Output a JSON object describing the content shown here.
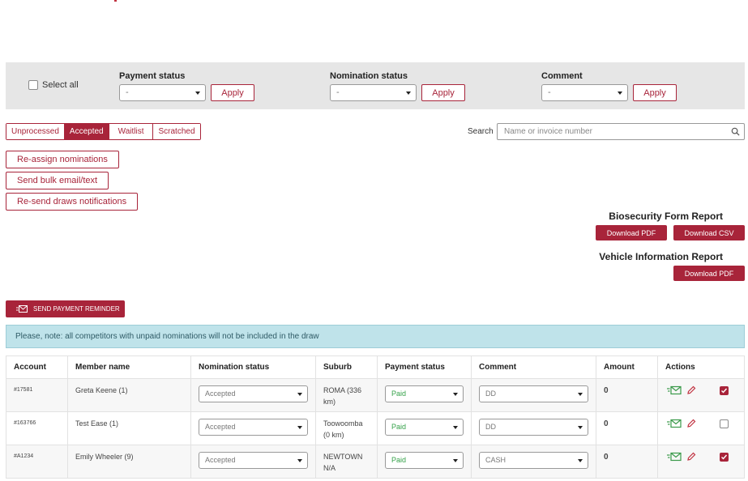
{
  "filters": {
    "select_all_label": "Select all",
    "payment_status": {
      "label": "Payment status",
      "value": "-",
      "apply_label": "Apply"
    },
    "nomination_status": {
      "label": "Nomination status",
      "value": "-",
      "apply_label": "Apply"
    },
    "comment": {
      "label": "Comment",
      "value": "-",
      "apply_label": "Apply"
    }
  },
  "tabs": [
    {
      "label": "Unprocessed",
      "active": false
    },
    {
      "label": "Accepted",
      "active": true
    },
    {
      "label": "Waitlist",
      "active": false
    },
    {
      "label": "Scratched",
      "active": false
    }
  ],
  "search": {
    "label": "Search",
    "placeholder": "Name or invoice number"
  },
  "actions": {
    "reassign": "Re-assign nominations",
    "bulk_email": "Send bulk email/text",
    "resend_draws": "Re-send draws notifications"
  },
  "reports": {
    "biosecurity": {
      "title": "Biosecurity Form Report",
      "pdf": "Download PDF",
      "csv": "Download CSV"
    },
    "vehicle": {
      "title": "Vehicle Information Report",
      "pdf": "Download PDF"
    }
  },
  "reminder_label": "SEND PAYMENT REMINDER",
  "notice": "Please, note: all competitors with unpaid nominations will not be included in the draw",
  "table": {
    "headers": {
      "account": "Account",
      "member": "Member name",
      "nomination": "Nomination status",
      "suburb": "Suburb",
      "payment": "Payment status",
      "comment": "Comment",
      "amount": "Amount",
      "actions": "Actions"
    },
    "rows": [
      {
        "account": "#17581",
        "member": "Greta Keene (1)",
        "nomination": "Accepted",
        "suburb": "ROMA (336 km)",
        "payment": "Paid",
        "comment": "DD",
        "amount": "0",
        "checked": true
      },
      {
        "account": "#163766",
        "member": "Test Ease (1)",
        "nomination": "Accepted",
        "suburb": "Toowoomba (0 km)",
        "payment": "Paid",
        "comment": "DD",
        "amount": "0",
        "checked": false
      },
      {
        "account": "#A1234",
        "member": "Emily Wheeler (9)",
        "nomination": "Accepted",
        "suburb": "NEWTOWN N/A",
        "payment": "Paid",
        "comment": "CASH",
        "amount": "0",
        "checked": true
      }
    ]
  },
  "colors": {
    "brand": "#a8243a",
    "paid": "#36a24a",
    "notice_bg": "#bfe3ea",
    "email_icon": "#3a9a4a"
  }
}
